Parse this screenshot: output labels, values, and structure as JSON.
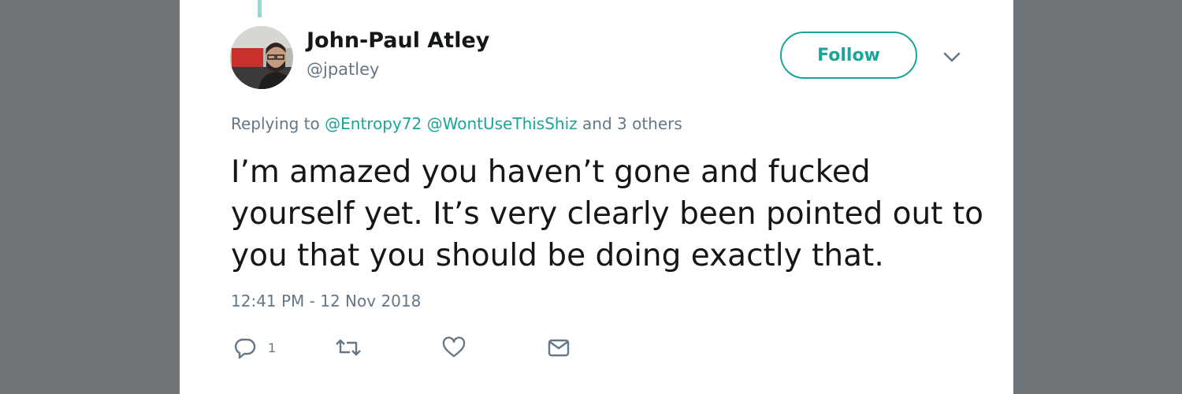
{
  "author": {
    "display_name": "John-Paul Atley",
    "handle": "@jpatley"
  },
  "follow_button": {
    "label": "Follow"
  },
  "reply_context": {
    "prefix": "Replying to",
    "mentions": [
      "@Entropy72",
      "@WontUseThisShiz"
    ],
    "suffix": "and 3 others"
  },
  "tweet": {
    "text": "I’m amazed you haven’t gone and fucked yourself yet. It’s very clearly been pointed out to you that you should be doing exactly that.",
    "timestamp": "12:41 PM - 12 Nov 2018"
  },
  "actions": {
    "reply_count": "1"
  },
  "icons": {
    "reply": "reply-icon",
    "retweet": "retweet-icon",
    "like": "heart-icon",
    "message": "envelope-icon",
    "caret": "chevron-down-icon"
  },
  "colors": {
    "accent": "#1aa59a",
    "text": "#14171a",
    "secondary_text": "#657786",
    "background": "#6f7478",
    "thread_line": "#8fdbd5"
  }
}
